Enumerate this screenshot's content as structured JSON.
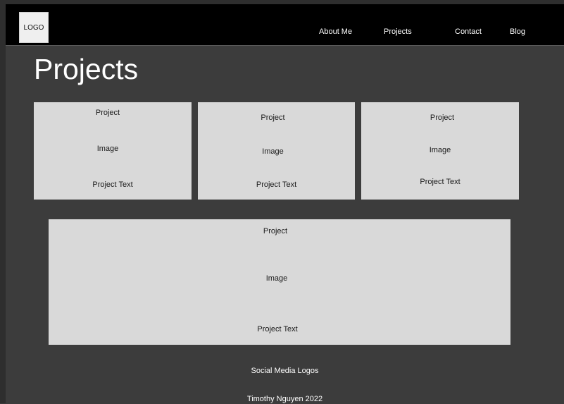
{
  "header": {
    "logo_label": "LOGO",
    "nav": [
      {
        "label": "About Me"
      },
      {
        "label": "Projects"
      },
      {
        "label": "Contact"
      },
      {
        "label": "Blog"
      }
    ]
  },
  "main": {
    "title": "Projects",
    "cards": [
      {
        "title": "Project",
        "image_label": "Image",
        "text": "Project Text"
      },
      {
        "title": "Project",
        "image_label": "Image",
        "text": "Project Text"
      },
      {
        "title": "Project",
        "image_label": "Image",
        "text": "Project Text"
      },
      {
        "title": "Project",
        "image_label": "Image",
        "text": "Project Text"
      }
    ]
  },
  "footer": {
    "social_label": "Social Media Logos",
    "copyright": "Timothy Nguyen 2022"
  },
  "colors": {
    "page_background": "#3c3c3c",
    "header_background": "#000000",
    "card_background": "#d9d9d9"
  }
}
